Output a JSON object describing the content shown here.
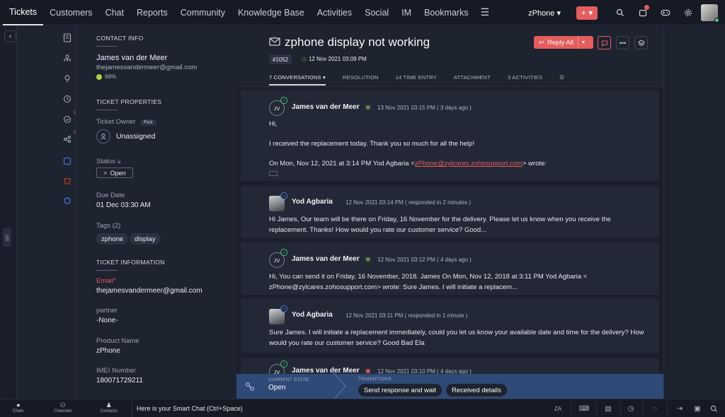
{
  "topnav": {
    "tabs": [
      "Tickets",
      "Customers",
      "Chat",
      "Reports",
      "Community",
      "Knowledge Base",
      "Activities",
      "Social",
      "IM",
      "Bookmarks"
    ],
    "more_icon": "hamburger-icon",
    "department": "zPhone ▾",
    "add_label": "+ ▾"
  },
  "contact": {
    "heading": "CONTACT INFO",
    "name": "James van der Meer",
    "email": "thejamesvandermeer@gmail.com",
    "happiness": "66%"
  },
  "properties": {
    "heading": "TICKET PROPERTIES",
    "owner_label": "Ticket Owner",
    "pick_label": "Pick",
    "owner_value": "Unassigned",
    "status_label": "Status",
    "status_value": "Open",
    "due_label": "Due Date",
    "due_value": "01 Dec 03:30 AM",
    "tags_label": "Tags (2)",
    "tags": [
      "zphone",
      "display"
    ]
  },
  "ticket_info": {
    "heading": "TICKET INFORMATION",
    "email_label": "Email",
    "email_value": "thejamesvandermeer@gmail.com",
    "partner_label": "partner",
    "partner_value": "-None-",
    "product_label": "Product Name",
    "product_value": "zPhone",
    "imei_label": "IMEI Number",
    "imei_value": "180071729211"
  },
  "ticket": {
    "subject": "zphone display not working",
    "number": "#1052",
    "created": "12 Nov 2021 03:09 PM",
    "reply_all_label": "Reply All",
    "tabs": [
      "7 CONVERSATIONS ▾",
      "RESOLUTION",
      "14 TIME ENTRY",
      "ATTACHMENT",
      "3 ACTIVITIES"
    ]
  },
  "threads": [
    {
      "initials": "JV",
      "author": "James van der Meer",
      "meta": "13 Nov 2021 03:15 PM ( 3 days ago )",
      "line1": "Hi,",
      "line2": "I received the replacement today. Thank you so much for all the help!",
      "line3_pre": "On Mon, Nov 12, 2021 at 3:14 PM Yod Agbaria <",
      "line3_link": "zPhone@zylcares.zohosupport.com",
      "line3_post": "> wrote:"
    },
    {
      "author": "Yod Agbaria",
      "meta": "12 Nov 2021 03:14 PM ( responded in 2 minutes )",
      "text": "Hi James, Our team will be there on Friday, 16 November for the delivery. Please let us know when you receive the replacement. Thanks! How would you rate our customer service? Good..."
    },
    {
      "initials": "JV",
      "author": "James van der Meer",
      "meta": "12 Nov 2021 03:12 PM ( 4 days ago )",
      "text": "Hi, You can send it on Friday, 16 November, 2018. James On Mon, Nov 12, 2018 at 3:11 PM Yod Agbaria < zPhone@zylcares.zohosupport.com> wrote: Sure James. I will initiate a replacem..."
    },
    {
      "author": "Yod Agbaria",
      "meta": "12 Nov 2021 03:11 PM ( responded in 1 minute )",
      "text": "Sure James. I will initiate a replacement immediately, could you let us know your available date and time for the delivery? How would you rate our customer service? Good Bad Ela"
    },
    {
      "initials": "JV",
      "author": "James van der Meer",
      "meta": "12 Nov 2021 03:10 PM ( 4 days ago )"
    }
  ],
  "transitions": {
    "current_label": "CURRENT STATE",
    "current_value": "Open",
    "label": "TRANSITIONS",
    "buttons": [
      "Send response and wait",
      "Received details"
    ]
  },
  "bottombar": {
    "chats": "Chats",
    "channels": "Channels",
    "contacts": "Contacts",
    "smart_chat": "Here is your Smart Chat (Ctrl+Space)",
    "lang": "ZA"
  },
  "colors": {
    "accent": "#e55d5d",
    "background": "#1e2330",
    "transition_bar": "#2f4a76"
  }
}
